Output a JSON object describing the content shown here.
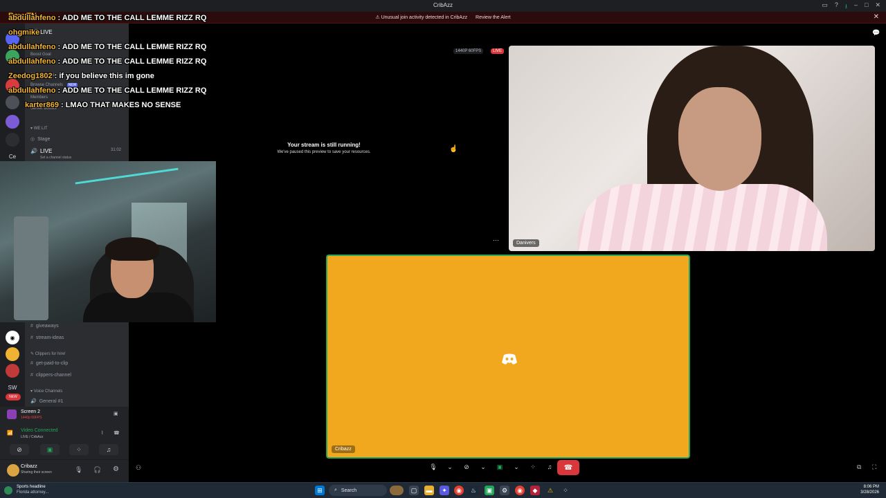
{
  "titlebar": {
    "app_title": "CribAzz"
  },
  "alert": {
    "message": "Unusual join activity detected in CribAzz",
    "link": "Review the Alert"
  },
  "chat": {
    "header": "RexyTN",
    "lines": [
      {
        "user": "abdullahfeno",
        "text": " : ADD ME TO THE CALL LEMME RIZZ RQ"
      },
      {
        "user": "ohgmike",
        "text": ""
      },
      {
        "user": "abdullahfeno",
        "text": " : ADD ME TO THE CALL LEMME RIZZ RQ"
      },
      {
        "user": "abdullahfeno",
        "text": " : ADD ME TO THE CALL LEMME RIZZ RQ"
      },
      {
        "user": "Zeedog1802",
        "text": " : if you believe this im gone"
      },
      {
        "user": "abdullahfeno",
        "text": " : ADD ME TO THE CALL LEMME RIZZ RQ"
      },
      {
        "user": "karter869",
        "text": " : LMAO THAT MAKES NO SENSE"
      }
    ]
  },
  "sidebar": {
    "live_header": "LIVE",
    "boost_goal": "Boost Goal",
    "boosts": "14/36 Boosts",
    "browse_channels": "Browse Channels",
    "new_badge": "NEW",
    "members": "Members",
    "server_boosts": "Server Boosts",
    "category_we_lit": "WE LIT",
    "channel_stage": "Stage",
    "channel_live": "LIVE",
    "channel_live_timer": "31:02",
    "channel_status": "Set a channel status",
    "channel_giveaways": "giveaways",
    "channel_stream_ideas": "stream-ideas",
    "category_clippers": "Clippers for hire!",
    "channel_get_paid": "get-paid-to-clip",
    "channel_clippers": "clippers-channel",
    "category_voice": "Voice Channels",
    "channel_general": "General #1"
  },
  "rail": {
    "ce": "Ce",
    "sw": "SW",
    "new": "NEW"
  },
  "voice_panel": {
    "screen_title": "Screen 2",
    "screen_sub": "1440p 60FPS",
    "status": "Video Connected",
    "channel": "LIVE / CribAzz"
  },
  "user_panel": {
    "username": "Cribazz",
    "status": "Sharing their screen"
  },
  "stream": {
    "paused_title": "Your stream is still running!",
    "paused_sub": "We've paused this preview to save your resources.",
    "quality": "1440P 60FPS",
    "live": "LIVE"
  },
  "tiles": {
    "danivers": "Danivers",
    "cribazz": "Cribazz"
  },
  "taskbar": {
    "news_title": "Sports headline",
    "news_sub": "Florida attorney...",
    "search": "Search",
    "time": "8:06 PM",
    "date": "3/28/2026"
  },
  "colors": {
    "accent_green": "#23a55a",
    "hangup_red": "#da373c",
    "tile_orange": "#f2a81e",
    "chat_user": "#f5b731"
  }
}
